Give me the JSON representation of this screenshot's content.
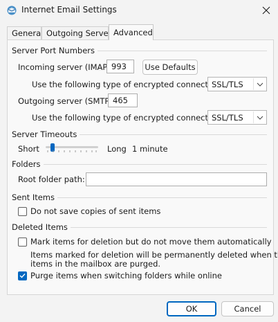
{
  "window": {
    "title": "Internet Email Settings",
    "icon": "outlook-icon",
    "close_icon": "close-icon"
  },
  "tabs": [
    {
      "label": "General",
      "active": false
    },
    {
      "label": "Outgoing Server",
      "active": false
    },
    {
      "label": "Advanced",
      "active": true
    }
  ],
  "server_ports": {
    "heading": "Server Port Numbers",
    "incoming_label": "Incoming server (IMAP):",
    "incoming_value": "993",
    "use_defaults": "Use Defaults",
    "encrypt_label_in": "Use the following type of encrypted connection:",
    "encrypt_value_in": "SSL/TLS",
    "outgoing_label": "Outgoing server (SMTP):",
    "outgoing_value": "465",
    "encrypt_label_out": "Use the following type of encrypted connection:",
    "encrypt_value_out": "SSL/TLS"
  },
  "timeouts": {
    "heading": "Server Timeouts",
    "short_label": "Short",
    "long_label": "Long",
    "value_text": "1 minute",
    "level_fraction": 0.1
  },
  "folders": {
    "heading": "Folders",
    "root_label": "Root folder path:",
    "root_value": ""
  },
  "sent_items": {
    "heading": "Sent Items",
    "no_copies_label": "Do not save copies of sent items",
    "no_copies_checked": false
  },
  "deleted_items": {
    "heading": "Deleted Items",
    "mark_label": "Mark items for deletion but do not move them automatically",
    "mark_checked": false,
    "note_line1": "Items marked for deletion will be permanently deleted when the",
    "note_line2": "items in the mailbox are purged.",
    "purge_label": "Purge items when switching folders while online",
    "purge_checked": true
  },
  "footer": {
    "ok": "OK",
    "cancel": "Cancel"
  },
  "colors": {
    "accent": "#0067c0",
    "background": "#f3f3f3"
  }
}
